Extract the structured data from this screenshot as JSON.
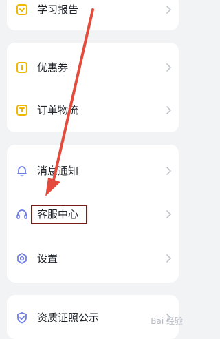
{
  "menu": {
    "group1": [
      {
        "label": "学习报告",
        "icon": "report-icon"
      }
    ],
    "group2": [
      {
        "label": "优惠券",
        "icon": "coupon-icon"
      },
      {
        "label": "订单物流",
        "icon": "package-icon"
      }
    ],
    "group3": [
      {
        "label": "消息通知",
        "icon": "bell-icon"
      },
      {
        "label": "客服中心",
        "icon": "headset-icon"
      },
      {
        "label": "设置",
        "icon": "settings-icon"
      }
    ],
    "group4": [
      {
        "label": "资质证照公示",
        "icon": "shield-check-icon"
      }
    ]
  },
  "annotation": {
    "arrow_color": "#e34b3c",
    "box_color": "#7a1d17"
  },
  "colors": {
    "icon_yellow": "#f1b600",
    "icon_blue": "#6f7de8"
  }
}
